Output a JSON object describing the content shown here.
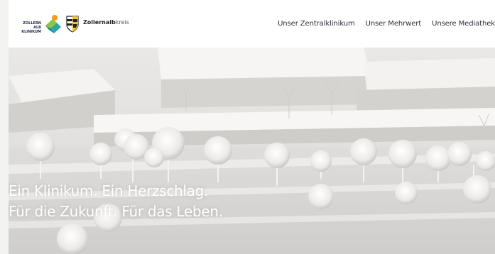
{
  "header": {
    "logo_clinic": {
      "lines": [
        "ZOLLERN",
        "ALB",
        "KLINIKUM"
      ]
    },
    "logo_district": {
      "name_bold": "Zollernalb",
      "name_regular": "kreis"
    }
  },
  "nav": {
    "items": [
      {
        "label": "Unser Zentralklinikum"
      },
      {
        "label": "Unser Mehrwert"
      },
      {
        "label": "Unsere Mediathek"
      }
    ]
  },
  "hero": {
    "headline_line1": "Ein Klinikum. Ein Herzschlag.",
    "headline_line2": "Für die Zukunft. Für das Leben."
  },
  "colors": {
    "brand_orange": "#f39a1e",
    "brand_green": "#8cc63f",
    "brand_teal": "#2aa8a0",
    "brand_navy": "#1e2a4a",
    "crest_yellow": "#f2c12e"
  }
}
